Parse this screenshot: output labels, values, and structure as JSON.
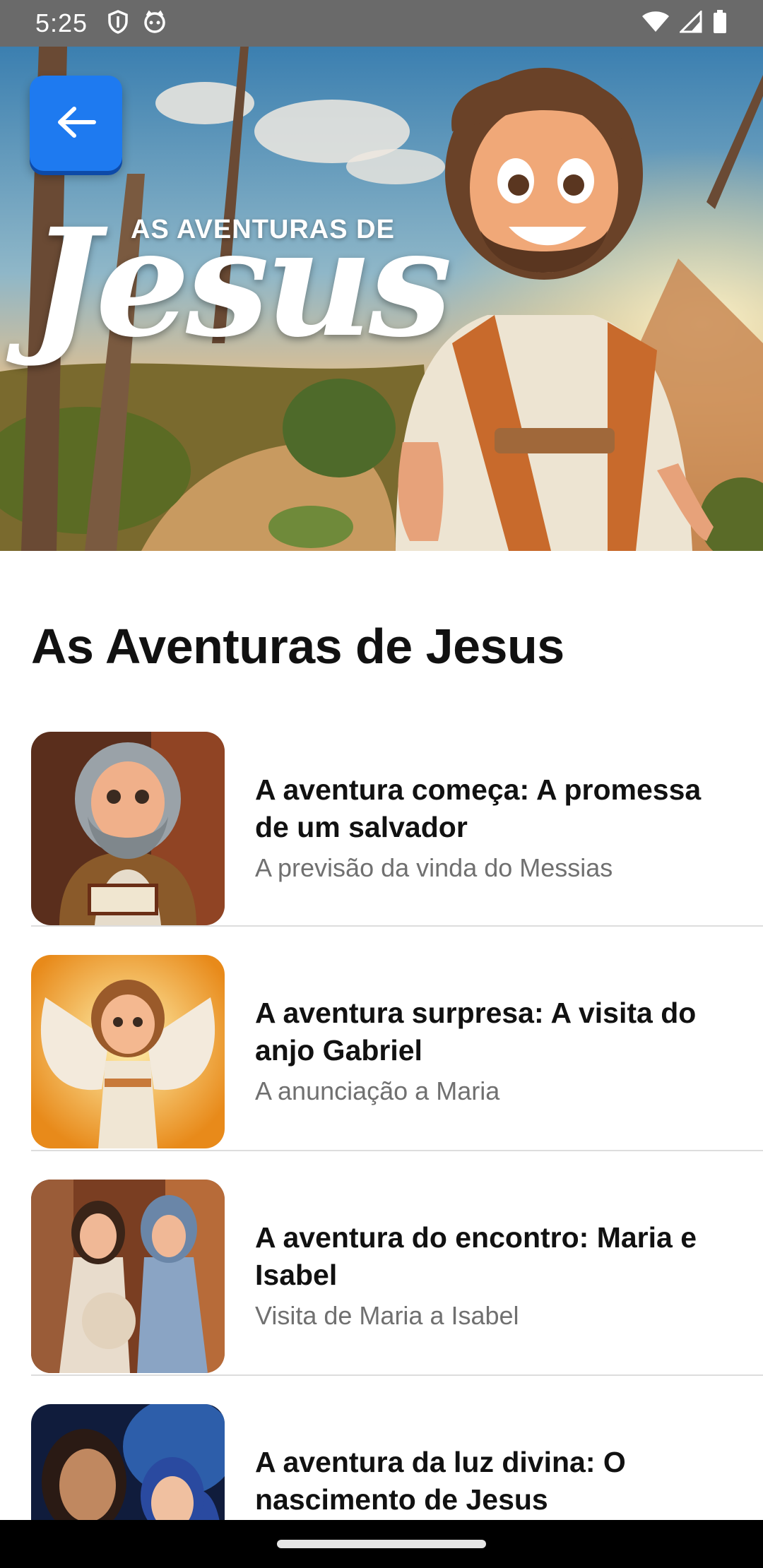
{
  "status_bar": {
    "time": "5:25",
    "left_icons": [
      "shield-icon",
      "cat-face-icon"
    ],
    "right_icons": [
      "wifi-icon",
      "signal-icon",
      "battery-icon"
    ]
  },
  "hero": {
    "kicker": "AS AVENTURAS DE",
    "script_title": "Jesus",
    "back_icon": "arrow-left-icon",
    "back_color": "#1e7af0"
  },
  "page_title": "As Aventuras de Jesus",
  "episodes": [
    {
      "title": "A aventura começa: A promessa de um salvador",
      "subtitle": "A previsão da vinda do Messias"
    },
    {
      "title": "A aventura surpresa: A visita do anjo Gabriel",
      "subtitle": "A anunciação a Maria"
    },
    {
      "title": "A aventura do encontro: Maria e Isabel",
      "subtitle": "Visita de Maria a Isabel"
    },
    {
      "title": "A aventura da luz divina: O nascimento de Jesus",
      "subtitle": ""
    }
  ],
  "colors": {
    "accent": "#1e7af0",
    "title_text": "#111111",
    "subtitle_text": "#707070",
    "divider": "#dddddd"
  }
}
